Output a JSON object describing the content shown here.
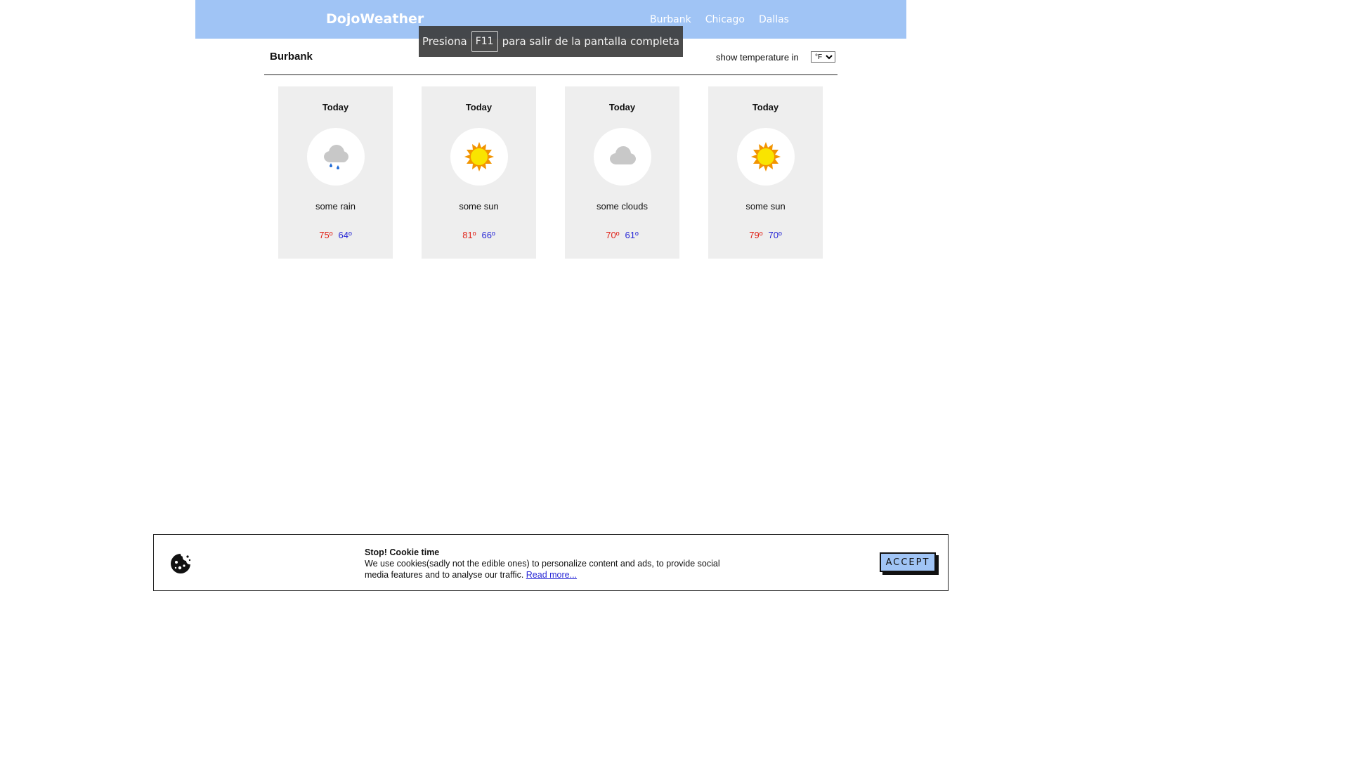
{
  "header": {
    "brand": "DojoWeather",
    "nav": [
      "Burbank",
      "Chicago",
      "Dallas"
    ],
    "bg_color": "#a0c4f5"
  },
  "fullscreen_notice": {
    "before": "Presiona",
    "key": "F11",
    "after": "para salir de la pantalla completa"
  },
  "subheader": {
    "city": "Burbank",
    "unit_label": "show temperature in",
    "unit_selected": "°F"
  },
  "cards": [
    {
      "day": "Today",
      "icon": "rain-cloud-icon",
      "desc": "some rain",
      "high": "75º",
      "low": "64º"
    },
    {
      "day": "Today",
      "icon": "sun-icon",
      "desc": "some sun",
      "high": "81º",
      "low": "66º"
    },
    {
      "day": "Today",
      "icon": "cloud-icon",
      "desc": "some clouds",
      "high": "70º",
      "low": "61º"
    },
    {
      "day": "Today",
      "icon": "sun-icon",
      "desc": "some sun",
      "high": "79º",
      "low": "70º"
    }
  ],
  "colors": {
    "high_temp": "#e0241a",
    "low_temp": "#2a2ad6",
    "card_bg": "#eeeeee"
  },
  "cookie": {
    "title": "Stop! Cookie time",
    "body": "We use cookies(sadly not the edible ones) to personalize content and ads, to provide social media features and to analyse our traffic.",
    "link": "Read more...",
    "accept": "ACCEPT",
    "icon": "cookie-icon"
  }
}
